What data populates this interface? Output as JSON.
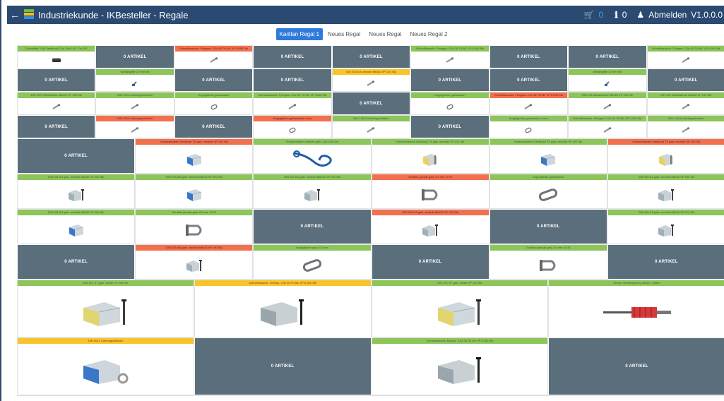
{
  "header": {
    "back_icon": "arrow-left-icon",
    "title": "Industriekunde - IKBesteller - Regale",
    "cart_count": "0",
    "info_count": "0",
    "logout_label": "Abmelden",
    "version": "V1.0.0.0"
  },
  "tabs": [
    {
      "label": "Karillan Regal 1",
      "active": true
    },
    {
      "label": "Neues Regal",
      "active": false
    },
    {
      "label": "Neues Regal",
      "active": false
    },
    {
      "label": "Neues Regal 2",
      "active": false
    }
  ],
  "empty_label": "0 ARTIKEL",
  "colors": {
    "header": "#2b4a72",
    "empty": "#5a6e7c",
    "green": "#8cc55a",
    "orange": "#f2704e",
    "yellow": "#f8c42a",
    "tab_active": "#2f7bdc"
  },
  "small_rows": [
    [
      {
        "label": "Drahtstifte 7040 Senkkopf 2,8x 2,8x 100, 70x 100",
        "color": "green",
        "icon": "nails-box"
      },
      {
        "empty": true
      },
      {
        "label": "Schnellbauschr. Feingew. 3,5x 35 TN ML VP 5.000 Stk",
        "color": "orange",
        "icon": "screws"
      },
      {
        "empty": true
      },
      {
        "empty": true
      },
      {
        "label": "Schnellbauschr. Feingew. 3,5x 35 TN ML VP 5.000 Stk",
        "color": "green",
        "icon": "screws"
      },
      {
        "empty": true
      },
      {
        "empty": true
      },
      {
        "label": "Schnellbauschr. Feingew. 3,5x 35 TN ML VP 5.000 Stk",
        "color": "green",
        "icon": "screws"
      }
    ],
    [
      {
        "empty": true
      },
      {
        "label": "Weldingriffe 10 mm M4",
        "color": "green",
        "icon": "anchor"
      },
      {
        "empty": true
      },
      {
        "empty": true
      },
      {
        "label": "DIN 933 8.8 verzinkt M6x30 VP 100 Stk",
        "color": "yellow",
        "icon": "screws"
      },
      {
        "empty": true
      },
      {
        "empty": true
      },
      {
        "label": "Weldingriffe 10 mm M4",
        "color": "green",
        "icon": "anchor"
      },
      {
        "empty": true
      }
    ],
    [
      {
        "label": "DIN 912 Edelstahl A2 M4x20 VP 100 Stk",
        "color": "green",
        "icon": "screws"
      },
      {
        "label": "DIN 125 A Unterlegscheiben",
        "color": "green",
        "icon": "screws"
      },
      {
        "label": "Kopplglieder galvanisiert",
        "color": "green",
        "icon": "link"
      },
      {
        "label": "Schnellbauschr. Feingew. 3,5x 35 TN ML VP 5.000 Stk",
        "color": "green",
        "icon": "screws"
      },
      {
        "empty": true
      },
      {
        "label": "Kopplglieder galvanisiert",
        "color": "green",
        "icon": "link"
      },
      {
        "label": "Schnellbauschr. Feingew. 3,5x 35 TN ML VP 5.000 Stk",
        "color": "orange",
        "icon": "screws"
      },
      {
        "label": "DIN 912 Edelstahl A2 M4x20 VP 100 Stk",
        "color": "green",
        "icon": "screws"
      },
      {
        "label": "DIN 912 Edelstahl A2 M4x20 VP 100 Stk",
        "color": "green",
        "icon": "screws"
      }
    ],
    [
      {
        "empty": true
      },
      {
        "label": "DIN 125 A Unterlegscheiben",
        "color": "orange",
        "icon": "screws"
      },
      {
        "empty": true
      },
      {
        "label": "Kopplglieder galvanisiert 4 mm",
        "color": "orange",
        "icon": "link"
      },
      {
        "label": "DIN 125 A Unterlegscheiben",
        "color": "green",
        "icon": "screws"
      },
      {
        "empty": true
      },
      {
        "label": "Kopplglieder galvanisiert 4 mm",
        "color": "green",
        "icon": "link"
      },
      {
        "label": "Schnellbauschr. Feingew. 3,5x 35 TN ML VP 5.000 Stk",
        "color": "green",
        "icon": "screws"
      },
      {
        "label": "DIN 125 A Unterlegscheiben",
        "color": "green",
        "icon": "screws"
      }
    ]
  ],
  "medium_rows": [
    [
      {
        "empty": true
      },
      {
        "label": "Holzschrauben Senkkopf TX galv. verzinkt VP 100 Stk",
        "color": "orange",
        "icon": "box-blue"
      },
      {
        "label": "Schraubhaken verzinkt galv. 2,8x 100 mm",
        "color": "green",
        "icon": "hook"
      },
      {
        "label": "Holzschrauben Senkkopf TX galv. verzinkt VP 100 Stk",
        "color": "green",
        "icon": "box-yellow"
      },
      {
        "label": "Holzschrauben Senkkopf TX galv. verzinkt VP 100 Stk",
        "color": "green",
        "icon": "box-blue"
      },
      {
        "label": "Holzschrauben Senkkopf TX galv. verzinkt VP 100 Stk",
        "color": "orange",
        "icon": "box-yellow"
      }
    ],
    [
      {
        "label": "DIN 933 8.8 galv. verzinkt M6x30 VP 100 Stk",
        "color": "green",
        "icon": "box-bolt"
      },
      {
        "label": "DIN 933 8.8 galv. verzinkt M6x30 VP 100 Stk",
        "color": "green",
        "icon": "box-blue"
      },
      {
        "label": "DIN 933 8.8 galv. verzinkt M6x30 VP 100 Stk",
        "color": "green",
        "icon": "box-bolt"
      },
      {
        "label": "Schäkel gerade galv. 8,0 mm 10 St",
        "color": "orange",
        "icon": "shackle"
      },
      {
        "label": "Kopplglieder galvanisiert",
        "color": "green",
        "icon": "link-big"
      },
      {
        "label": "DIN 933 8.8 galv. verzinkt M6x30 VP 100 Stk",
        "color": "green",
        "icon": "box-bolt"
      }
    ],
    [
      {
        "label": "DIN 933 8.8 galv. verzinkt M6x30 VP 100 Stk",
        "color": "green",
        "icon": "box-blue"
      },
      {
        "label": "Schäkel gerade galv. 8,0 mm 10 St",
        "color": "green",
        "icon": "shackle"
      },
      {
        "empty": true
      },
      {
        "label": "DIN 933 8.8 galv. verzinkt M6x30 VP 100 Stk",
        "color": "orange",
        "icon": "box-bolt"
      },
      {
        "empty": true
      },
      {
        "label": "DIN 933 8.8 galv. verzinkt M6x30 VP 100 Stk",
        "color": "green",
        "icon": "box-bolt"
      }
    ],
    [
      {
        "empty": true
      },
      {
        "label": "DIN 933 8.8 galv. verzinkt M6x30 VP 100 Stk",
        "color": "orange",
        "icon": "box-bolt"
      },
      {
        "label": "Kopplglieder galv. 4,0 mm",
        "color": "green",
        "icon": "link-big"
      },
      {
        "empty": true
      },
      {
        "label": "Schäkel gerade galv. 8,0 mm 10 St",
        "color": "green",
        "icon": "shackle"
      },
      {
        "empty": true
      }
    ]
  ],
  "large_rows": [
    [
      {
        "label": "DIN 571 ST galv. 10x80 VP 100 Stk",
        "color": "green",
        "icon": "box-nail"
      },
      {
        "label": "Schnellbauschr. Senkop. 3,5x 35 TN ML VP 5.000 Stk",
        "color": "yellow",
        "icon": "box-nail-dark"
      },
      {
        "label": "DIN 571 ST galv. 10x80 VP 100 Stk",
        "color": "green",
        "icon": "box-nail"
      },
      {
        "label": "Bohrer Verlaengerung 25x60 / Stufen",
        "color": "green",
        "icon": "chisel"
      }
    ],
    [
      {
        "label": "DIN 9021 Unterlegscheiben",
        "color": "yellow",
        "icon": "box-washer"
      },
      {
        "empty": true
      },
      {
        "label": "Schnellbauschr. Bohrsp. 3,5x 35 TN ML VP 5.000 Stk",
        "color": "green",
        "icon": "box-nail-dark"
      },
      {
        "empty": true
      }
    ]
  ]
}
